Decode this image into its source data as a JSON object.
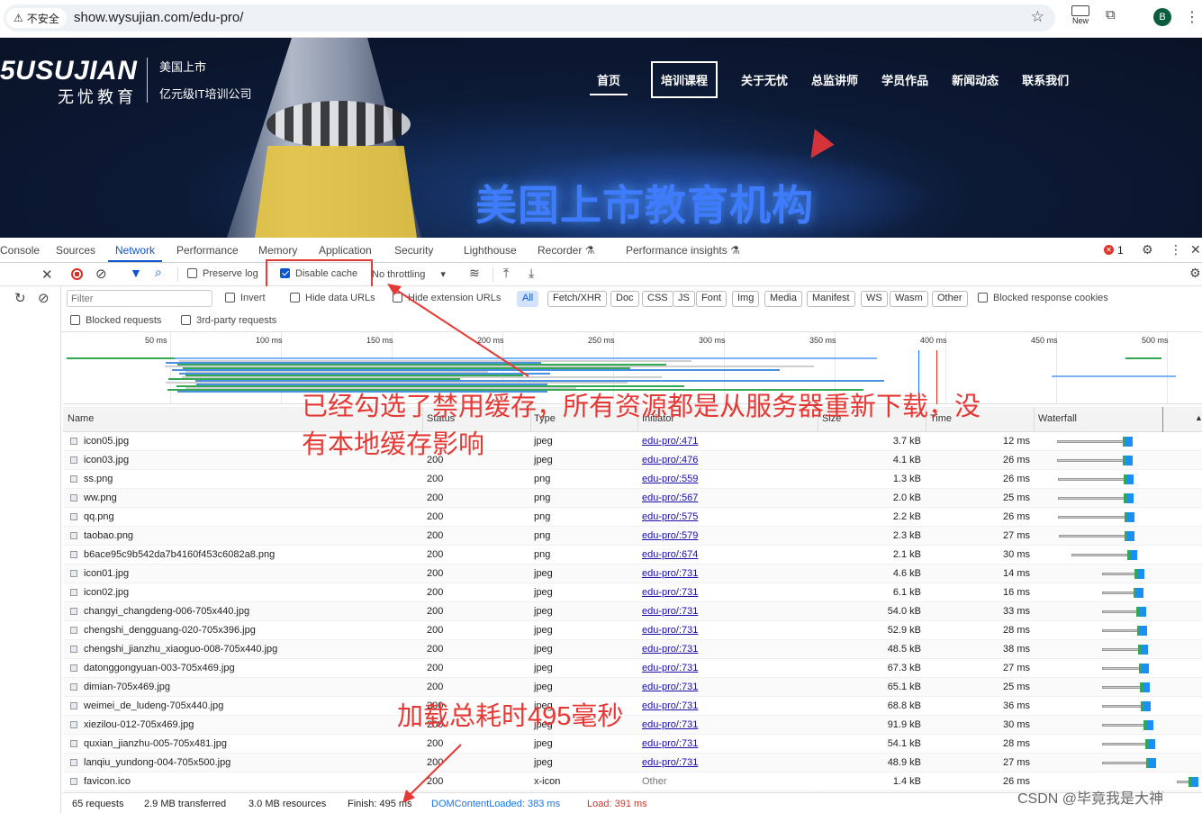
{
  "browser": {
    "security_label": "不安全",
    "url": "show.wysujian.com/edu-pro/",
    "new_label": "New",
    "profile_initial": "B"
  },
  "site": {
    "logo_main": "5USUJIAN",
    "logo_sub": "无忧教育",
    "logo_right_1": "美国上市",
    "logo_right_2": "亿元级IT培训公司",
    "nav": [
      "首页",
      "培训课程",
      "关于无忧",
      "总监讲师",
      "学员作品",
      "新闻动态",
      "联系我们"
    ],
    "hero_text": "美国上市教育机构"
  },
  "devtools": {
    "tabs": [
      "Console",
      "Sources",
      "Network",
      "Performance",
      "Memory",
      "Application",
      "Security",
      "Lighthouse",
      "Recorder",
      "Performance insights"
    ],
    "active_tab": "Network",
    "error_count": "1",
    "toolbar": {
      "preserve_log": "Preserve log",
      "disable_cache": "Disable cache",
      "throttling": "No throttling"
    },
    "filter": {
      "placeholder": "Filter",
      "invert": "Invert",
      "hide_data_urls": "Hide data URLs",
      "hide_extension_urls": "Hide extension URLs",
      "types": [
        "All",
        "Fetch/XHR",
        "Doc",
        "CSS",
        "JS",
        "Font",
        "Img",
        "Media",
        "Manifest",
        "WS",
        "Wasm",
        "Other"
      ],
      "blocked_response_cookies": "Blocked response cookies",
      "blocked_requests": "Blocked requests",
      "third_party": "3rd-party requests"
    },
    "overview_ticks": [
      "50 ms",
      "100 ms",
      "150 ms",
      "200 ms",
      "250 ms",
      "300 ms",
      "350 ms",
      "400 ms",
      "450 ms",
      "500 ms"
    ],
    "columns": [
      "Name",
      "Status",
      "Type",
      "Initiator",
      "Size",
      "Time",
      "Waterfall"
    ],
    "rows": [
      {
        "name": "icon05.jpg",
        "status": "",
        "type": "jpeg",
        "initiator": "edu-pro/:471",
        "size": "3.7 kB",
        "time": "12 ms"
      },
      {
        "name": "icon03.jpg",
        "status": "200",
        "type": "jpeg",
        "initiator": "edu-pro/:476",
        "size": "4.1 kB",
        "time": "26 ms"
      },
      {
        "name": "ss.png",
        "status": "200",
        "type": "png",
        "initiator": "edu-pro/:559",
        "size": "1.3 kB",
        "time": "26 ms"
      },
      {
        "name": "ww.png",
        "status": "200",
        "type": "png",
        "initiator": "edu-pro/:567",
        "size": "2.0 kB",
        "time": "25 ms"
      },
      {
        "name": "qq.png",
        "status": "200",
        "type": "png",
        "initiator": "edu-pro/:575",
        "size": "2.2 kB",
        "time": "26 ms"
      },
      {
        "name": "taobao.png",
        "status": "200",
        "type": "png",
        "initiator": "edu-pro/:579",
        "size": "2.3 kB",
        "time": "27 ms"
      },
      {
        "name": "b6ace95c9b542da7b4160f453c6082a8.png",
        "status": "200",
        "type": "png",
        "initiator": "edu-pro/:674",
        "size": "2.1 kB",
        "time": "30 ms"
      },
      {
        "name": "icon01.jpg",
        "status": "200",
        "type": "jpeg",
        "initiator": "edu-pro/:731",
        "size": "4.6 kB",
        "time": "14 ms"
      },
      {
        "name": "icon02.jpg",
        "status": "200",
        "type": "jpeg",
        "initiator": "edu-pro/:731",
        "size": "6.1 kB",
        "time": "16 ms"
      },
      {
        "name": "changyi_changdeng-006-705x440.jpg",
        "status": "200",
        "type": "jpeg",
        "initiator": "edu-pro/:731",
        "size": "54.0 kB",
        "time": "33 ms"
      },
      {
        "name": "chengshi_dengguang-020-705x396.jpg",
        "status": "200",
        "type": "jpeg",
        "initiator": "edu-pro/:731",
        "size": "52.9 kB",
        "time": "28 ms"
      },
      {
        "name": "chengshi_jianzhu_xiaoguo-008-705x440.jpg",
        "status": "200",
        "type": "jpeg",
        "initiator": "edu-pro/:731",
        "size": "48.5 kB",
        "time": "38 ms"
      },
      {
        "name": "datonggongyuan-003-705x469.jpg",
        "status": "200",
        "type": "jpeg",
        "initiator": "edu-pro/:731",
        "size": "67.3 kB",
        "time": "27 ms"
      },
      {
        "name": "dimian-705x469.jpg",
        "status": "200",
        "type": "jpeg",
        "initiator": "edu-pro/:731",
        "size": "65.1 kB",
        "time": "25 ms"
      },
      {
        "name": "weimei_de_ludeng-705x440.jpg",
        "status": "200",
        "type": "jpeg",
        "initiator": "edu-pro/:731",
        "size": "68.8 kB",
        "time": "36 ms"
      },
      {
        "name": "xiezilou-012-705x469.jpg",
        "status": "200",
        "type": "jpeg",
        "initiator": "edu-pro/:731",
        "size": "91.9 kB",
        "time": "30 ms"
      },
      {
        "name": "quxian_jianzhu-005-705x481.jpg",
        "status": "200",
        "type": "jpeg",
        "initiator": "edu-pro/:731",
        "size": "54.1 kB",
        "time": "28 ms"
      },
      {
        "name": "lanqiu_yundong-004-705x500.jpg",
        "status": "200",
        "type": "jpeg",
        "initiator": "edu-pro/:731",
        "size": "48.9 kB",
        "time": "27 ms"
      },
      {
        "name": "favicon.ico",
        "status": "200",
        "type": "x-icon",
        "initiator": "Other",
        "size": "1.4 kB",
        "time": "26 ms"
      }
    ],
    "status_bar": {
      "requests": "65 requests",
      "transferred": "2.9 MB transferred",
      "resources": "3.0 MB resources",
      "finish": "Finish: 495 ms",
      "dom_content_loaded": "DOMContentLoaded: 383 ms",
      "load": "Load: 391 ms"
    }
  },
  "annotations": {
    "note_1_line_1": "已经勾选了禁用缓存，所有资源都是从服务器重新下载，没",
    "note_1_line_2": "有本地缓存影响",
    "note_2": "加载总耗时495毫秒"
  },
  "watermark": "CSDN @毕竟我是大神",
  "colors": {
    "accent": "#0b57d0",
    "annotation": "#e53935",
    "waterfall_download": "#1a90f2",
    "waterfall_receive": "#34a853"
  }
}
